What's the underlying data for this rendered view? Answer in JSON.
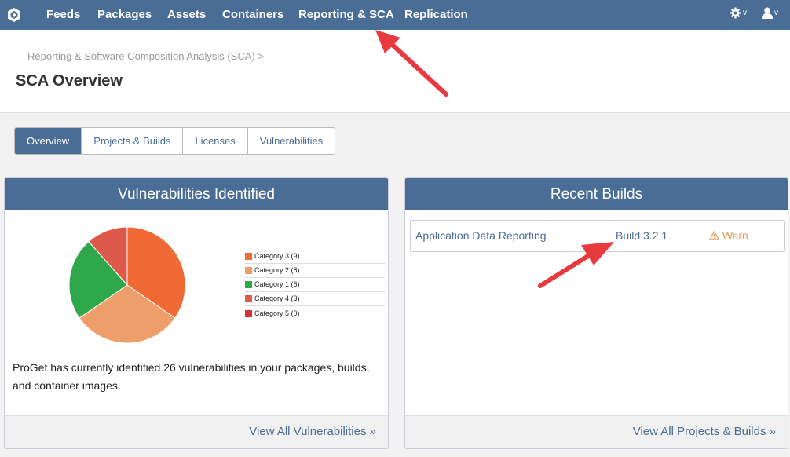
{
  "nav": {
    "items": [
      "Feeds",
      "Packages",
      "Assets",
      "Containers",
      "Reporting & SCA",
      "Replication"
    ],
    "settings_caret": "v",
    "user_caret": "v"
  },
  "header": {
    "breadcrumb": "Reporting & Software Composition Analysis (SCA) >",
    "title": "SCA Overview"
  },
  "tabs": [
    "Overview",
    "Projects & Builds",
    "Licenses",
    "Vulnerabilities"
  ],
  "vulnerabilities": {
    "title": "Vulnerabilities Identified",
    "description": "ProGet has currently identified 26 vulnerabilities in your packages, builds, and container images.",
    "footer_link": "View All Vulnerabilities »"
  },
  "chart_data": {
    "type": "pie",
    "title": "",
    "categories": [
      "Category 3 (9)",
      "Category 2 (8)",
      "Category 1 (6)",
      "Category 4 (3)",
      "Category 5 (0)"
    ],
    "values": [
      9,
      8,
      6,
      3,
      0
    ],
    "colors": [
      "#f06a35",
      "#ee9e6a",
      "#2ea84a",
      "#dd5a4a",
      "#d7302f"
    ],
    "legend_position": "right"
  },
  "recent_builds": {
    "title": "Recent Builds",
    "builds": [
      {
        "project": "Application Data Reporting",
        "build": "Build 3.2.1",
        "status": "Warn"
      }
    ],
    "footer_link": "View All Projects & Builds »"
  },
  "colors": {
    "brand": "#4a6d95",
    "warn": "#e69a5a",
    "annotation_arrow": "#e8393f"
  }
}
